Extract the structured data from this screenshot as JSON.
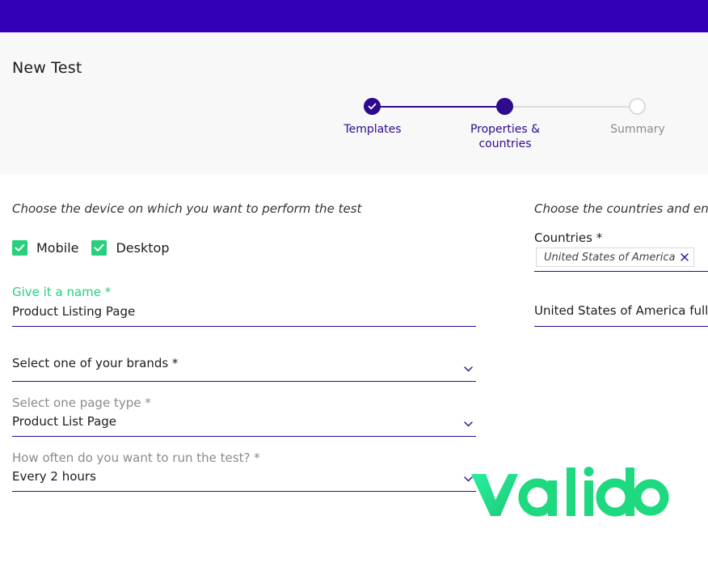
{
  "header": {
    "title": "New Test"
  },
  "stepper": {
    "steps": [
      {
        "label_line1": "Templates",
        "label_line2": "",
        "state": "done"
      },
      {
        "label_line1": "Properties &",
        "label_line2": "countries",
        "state": "current"
      },
      {
        "label_line1": "Summary",
        "label_line2": "",
        "state": "todo"
      }
    ]
  },
  "device": {
    "hint": "Choose the device on which you want to perform the test",
    "options": [
      {
        "label": "Mobile",
        "checked": true
      },
      {
        "label": "Desktop",
        "checked": true
      }
    ]
  },
  "form": {
    "name": {
      "label": "Give it a name *",
      "value": "Product Listing Page"
    },
    "brand": {
      "placeholder": "Select one of your brands *",
      "value": ""
    },
    "page_type": {
      "label": "Select one page type *",
      "value": "Product List Page"
    },
    "frequency": {
      "label": "How often do you want to run the test? *",
      "value": "Every 2 hours"
    }
  },
  "countries": {
    "hint": "Choose the countries and ent",
    "label": "Countries *",
    "selected_chip": "United States of America",
    "entity_value": "United States of America full"
  },
  "logo": {
    "text": "valido"
  },
  "colors": {
    "brand_purple": "#3300b8",
    "step_purple": "#2e0a8c",
    "accent_green": "#26d07c",
    "logo_green": "#1ed97f"
  }
}
